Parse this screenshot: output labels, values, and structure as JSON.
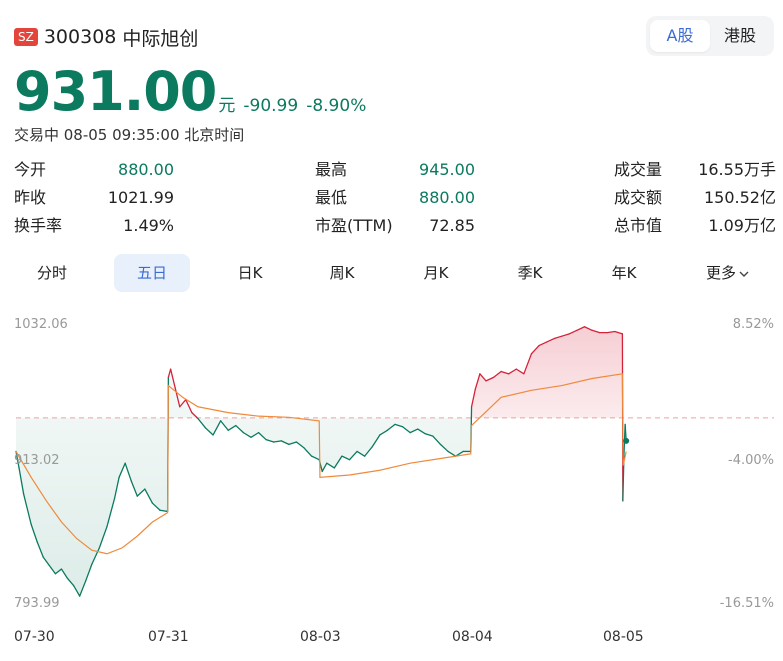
{
  "stock": {
    "exchange": "SZ",
    "code": "300308",
    "name": "中际旭创",
    "price": "931.00",
    "unit": "元",
    "change": "-90.99",
    "change_pct": "-8.90%",
    "status": "交易中 08-05 09:35:00 北京时间"
  },
  "market_toggle": {
    "a_label": "A股",
    "hk_label": "港股",
    "active": "A股"
  },
  "stats": [
    {
      "label": "今开",
      "value": "880.00",
      "color": "green"
    },
    {
      "label": "最高",
      "value": "945.00",
      "color": "green"
    },
    {
      "label": "成交量",
      "value": "16.55万手",
      "color": "default"
    },
    {
      "label": "昨收",
      "value": "1021.99",
      "color": "default"
    },
    {
      "label": "最低",
      "value": "880.00",
      "color": "green"
    },
    {
      "label": "成交额",
      "value": "150.52亿",
      "color": "default"
    },
    {
      "label": "换手率",
      "value": "1.49%",
      "color": "default"
    },
    {
      "label": "市盈(TTM)",
      "value": "72.85",
      "color": "default"
    },
    {
      "label": "总市值",
      "value": "1.09万亿",
      "color": "default"
    }
  ],
  "tabs": [
    {
      "label": "分时"
    },
    {
      "label": "五日"
    },
    {
      "label": "日K"
    },
    {
      "label": "周K"
    },
    {
      "label": "月K"
    },
    {
      "label": "季K"
    },
    {
      "label": "年K"
    },
    {
      "label": "更多"
    }
  ],
  "active_tab": "五日",
  "colors": {
    "up": "#d4223a",
    "down": "#0b7a5e",
    "avg": "#ef8a3c",
    "baseline": "#f0a0a0",
    "accent": "#3a6bd6"
  },
  "chart_data": {
    "type": "line",
    "y_left": {
      "top": "1032.06",
      "mid": "913.02",
      "bottom": "793.99"
    },
    "y_right": {
      "top": "8.52%",
      "mid": "-4.00%",
      "bottom": "-16.51%"
    },
    "ylim": [
      793.99,
      1032.06
    ],
    "x_labels": [
      "07-30",
      "07-31",
      "08-03",
      "08-04",
      "08-05"
    ],
    "prev_close": 950.5,
    "series": [
      {
        "values": [
          [
            0.0,
            922
          ],
          [
            0.02,
            908
          ],
          [
            0.05,
            886
          ],
          [
            0.1,
            860
          ],
          [
            0.14,
            845
          ],
          [
            0.18,
            832
          ],
          [
            0.22,
            825
          ],
          [
            0.26,
            818
          ],
          [
            0.3,
            822
          ],
          [
            0.34,
            814
          ],
          [
            0.38,
            808
          ],
          [
            0.42,
            799
          ],
          [
            0.46,
            812
          ],
          [
            0.5,
            826
          ],
          [
            0.55,
            840
          ],
          [
            0.6,
            858
          ],
          [
            0.65,
            882
          ],
          [
            0.68,
            900
          ],
          [
            0.72,
            912
          ],
          [
            0.76,
            897
          ],
          [
            0.8,
            884
          ],
          [
            0.85,
            890
          ],
          [
            0.9,
            878
          ],
          [
            0.95,
            872
          ],
          [
            1.0,
            871
          ],
          [
            1.005,
            985
          ],
          [
            1.02,
            992
          ],
          [
            1.05,
            976
          ],
          [
            1.08,
            960
          ],
          [
            1.12,
            966
          ],
          [
            1.16,
            955
          ],
          [
            1.2,
            950
          ],
          [
            1.25,
            942
          ],
          [
            1.3,
            936
          ],
          [
            1.35,
            948
          ],
          [
            1.4,
            940
          ],
          [
            1.45,
            944
          ],
          [
            1.5,
            938
          ],
          [
            1.55,
            934
          ],
          [
            1.6,
            938
          ],
          [
            1.65,
            932
          ],
          [
            1.7,
            930
          ],
          [
            1.75,
            931
          ],
          [
            1.8,
            928
          ],
          [
            1.85,
            930
          ],
          [
            1.9,
            925
          ],
          [
            1.95,
            918
          ],
          [
            2.0,
            915
          ],
          [
            2.02,
            905
          ],
          [
            2.05,
            912
          ],
          [
            2.1,
            908
          ],
          [
            2.15,
            918
          ],
          [
            2.2,
            915
          ],
          [
            2.25,
            922
          ],
          [
            2.3,
            918
          ],
          [
            2.35,
            926
          ],
          [
            2.4,
            936
          ],
          [
            2.45,
            940
          ],
          [
            2.5,
            945
          ],
          [
            2.55,
            943
          ],
          [
            2.6,
            938
          ],
          [
            2.65,
            941
          ],
          [
            2.7,
            937
          ],
          [
            2.75,
            935
          ],
          [
            2.8,
            928
          ],
          [
            2.85,
            922
          ],
          [
            2.9,
            918
          ],
          [
            2.95,
            922
          ],
          [
            3.0,
            922
          ],
          [
            3.005,
            960
          ],
          [
            3.03,
            975
          ],
          [
            3.06,
            988
          ],
          [
            3.1,
            982
          ],
          [
            3.15,
            985
          ],
          [
            3.2,
            990
          ],
          [
            3.25,
            988
          ],
          [
            3.3,
            992
          ],
          [
            3.35,
            988
          ],
          [
            3.4,
            1005
          ],
          [
            3.45,
            1012
          ],
          [
            3.5,
            1015
          ],
          [
            3.55,
            1018
          ],
          [
            3.6,
            1020
          ],
          [
            3.65,
            1022
          ],
          [
            3.7,
            1025
          ],
          [
            3.75,
            1028
          ],
          [
            3.8,
            1025
          ],
          [
            3.85,
            1023
          ],
          [
            3.9,
            1023
          ],
          [
            3.95,
            1024
          ],
          [
            4.0,
            1022
          ],
          [
            4.003,
            880
          ],
          [
            4.01,
            918
          ],
          [
            4.018,
            945
          ],
          [
            4.025,
            931
          ]
        ]
      },
      {
        "values": [
          [
            0.0,
            922
          ],
          [
            0.1,
            900
          ],
          [
            0.2,
            880
          ],
          [
            0.3,
            862
          ],
          [
            0.4,
            848
          ],
          [
            0.5,
            838
          ],
          [
            0.6,
            835
          ],
          [
            0.7,
            840
          ],
          [
            0.8,
            850
          ],
          [
            0.9,
            862
          ],
          [
            1.0,
            870
          ],
          [
            1.005,
            978
          ],
          [
            1.1,
            968
          ],
          [
            1.2,
            960
          ],
          [
            1.4,
            955
          ],
          [
            1.6,
            952
          ],
          [
            1.8,
            951
          ],
          [
            2.0,
            948
          ],
          [
            2.005,
            900
          ],
          [
            2.2,
            902
          ],
          [
            2.4,
            906
          ],
          [
            2.6,
            912
          ],
          [
            2.8,
            916
          ],
          [
            3.0,
            920
          ],
          [
            3.005,
            944
          ],
          [
            3.2,
            968
          ],
          [
            3.4,
            974
          ],
          [
            3.6,
            978
          ],
          [
            3.8,
            984
          ],
          [
            4.0,
            988
          ],
          [
            4.005,
            910
          ],
          [
            4.025,
            922
          ]
        ]
      }
    ]
  }
}
